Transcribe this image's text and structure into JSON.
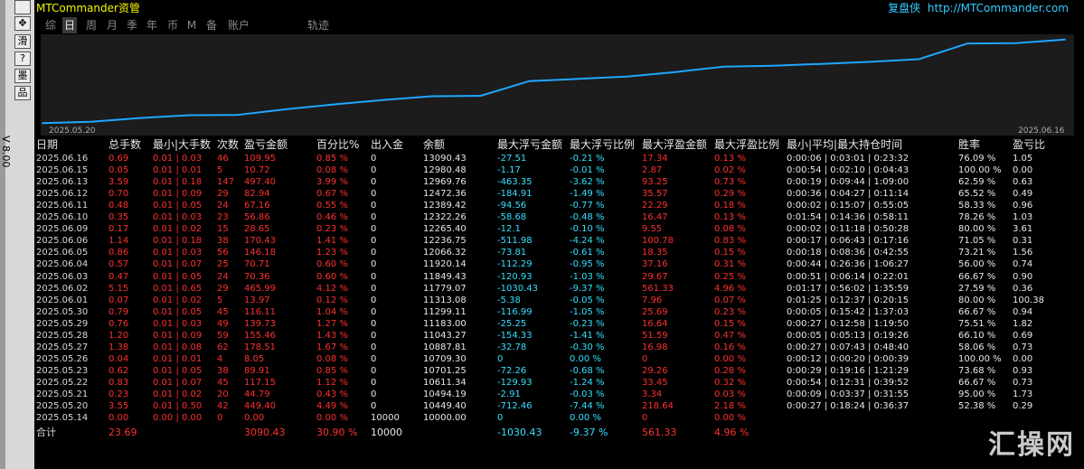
{
  "window": {
    "title": "MTCommander资管",
    "brand_cn": "复盘侠",
    "brand_url": "http://MTCommander.com"
  },
  "side": {
    "vertical_label": "V 8.00",
    "buttons": [
      "",
      "✥",
      "滑",
      "?",
      "墨",
      "品"
    ]
  },
  "tabs": [
    "综",
    "日",
    "周",
    "月",
    "季",
    "年",
    "币",
    "M",
    "备",
    "账户",
    "轨迹"
  ],
  "active_tab": 1,
  "chart_data": {
    "type": "line",
    "x_start_label": "2025.05.20",
    "x_end_label": "2025.06.16",
    "color": "#1ea7ff",
    "values": [
      10449.4,
      10494.19,
      10611.34,
      10701.25,
      10709.3,
      10887.81,
      11043.27,
      11183.0,
      11299.11,
      11313.08,
      11779.07,
      11849.43,
      11920.14,
      12066.32,
      12236.75,
      12265.4,
      12322.26,
      12389.42,
      12472.36,
      12969.76,
      12980.48,
      13090.43
    ]
  },
  "columns": [
    "日期",
    "总手数",
    "最小|大手数",
    "次数",
    "盈亏金额",
    "百分比%",
    "出入金",
    "余额",
    "最大浮亏金额",
    "最大浮亏比例",
    "最大浮盈金额",
    "最大浮盈比例",
    "最小|平均|最大持仓时间",
    "胜率",
    "盈亏比"
  ],
  "rows": [
    [
      "2025.06.16",
      "0.69",
      "0.01 | 0.03",
      "46",
      "109.95",
      "0.85 %",
      "0",
      "13090.43",
      "-27.51",
      "-0.21 %",
      "17.34",
      "0.13 %",
      "0:00:06 | 0:03:01 | 0:23:32",
      "76.09 %",
      "1.05"
    ],
    [
      "2025.06.15",
      "0.05",
      "0.01 | 0.01",
      "5",
      "10.72",
      "0.08 %",
      "0",
      "12980.48",
      "-1.17",
      "-0.01 %",
      "2.87",
      "0.02 %",
      "0:00:54 | 0:02:10 | 0:04:43",
      "100.00 %",
      "0.00"
    ],
    [
      "2025.06.13",
      "3.59",
      "0.01 | 0.18",
      "147",
      "497.40",
      "3.99 %",
      "0",
      "12969.76",
      "-463.35",
      "-3.62 %",
      "93.25",
      "0.73 %",
      "0:00:19 | 0:09:44 | 1:09:00",
      "62.59 %",
      "0.63"
    ],
    [
      "2025.06.12",
      "0.70",
      "0.01 | 0.09",
      "29",
      "82.94",
      "0.67 %",
      "0",
      "12472.36",
      "-184.91",
      "-1.49 %",
      "35.57",
      "0.29 %",
      "0:00:36 | 0:04:27 | 0:11:14",
      "65.52 %",
      "0.49"
    ],
    [
      "2025.06.11",
      "0.48",
      "0.01 | 0.05",
      "24",
      "67.16",
      "0.55 %",
      "0",
      "12389.42",
      "-94.56",
      "-0.77 %",
      "22.29",
      "0.18 %",
      "0:00:02 | 0:15:07 | 0:55:05",
      "58.33 %",
      "0.96"
    ],
    [
      "2025.06.10",
      "0.35",
      "0.01 | 0.03",
      "23",
      "56.86",
      "0.46 %",
      "0",
      "12322.26",
      "-58.68",
      "-0.48 %",
      "16.47",
      "0.13 %",
      "0:01:54 | 0:14:36 | 0:58:11",
      "78.26 %",
      "1.03"
    ],
    [
      "2025.06.09",
      "0.17",
      "0.01 | 0.02",
      "15",
      "28.65",
      "0.23 %",
      "0",
      "12265.40",
      "-12.1",
      "-0.10 %",
      "9.55",
      "0.08 %",
      "0:00:02 | 0:11:18 | 0:50:28",
      "80.00 %",
      "3.61"
    ],
    [
      "2025.06.06",
      "1.14",
      "0.01 | 0.18",
      "38",
      "170.43",
      "1.41 %",
      "0",
      "12236.75",
      "-511.98",
      "-4.24 %",
      "100.78",
      "0.83 %",
      "0:00:17 | 0:06:43 | 0:17:16",
      "71.05 %",
      "0.31"
    ],
    [
      "2025.06.05",
      "0.86",
      "0.01 | 0.03",
      "56",
      "146.18",
      "1.23 %",
      "0",
      "12066.32",
      "-73.81",
      "-0.61 %",
      "18.35",
      "0.15 %",
      "0:00:18 | 0:08:36 | 0:42:55",
      "73.21 %",
      "1.56"
    ],
    [
      "2025.06.04",
      "0.57",
      "0.01 | 0.07",
      "25",
      "70.71",
      "0.60 %",
      "0",
      "11920.14",
      "-112.29",
      "-0.95 %",
      "37.16",
      "0.31 %",
      "0:00:44 | 0:26:36 | 1:06:27",
      "56.00 %",
      "0.74"
    ],
    [
      "2025.06.03",
      "0.47",
      "0.01 | 0.05",
      "24",
      "70.36",
      "0.60 %",
      "0",
      "11849.43",
      "-120.93",
      "-1.03 %",
      "29.67",
      "0.25 %",
      "0:00:51 | 0:06:14 | 0:22:01",
      "66.67 %",
      "0.90"
    ],
    [
      "2025.06.02",
      "5.15",
      "0.01 | 0.65",
      "29",
      "465.99",
      "4.12 %",
      "0",
      "11779.07",
      "-1030.43",
      "-9.37 %",
      "561.33",
      "4.96 %",
      "0:01:17 | 0:56:02 | 1:35:59",
      "27.59 %",
      "0.36"
    ],
    [
      "2025.06.01",
      "0.07",
      "0.01 | 0.02",
      "5",
      "13.97",
      "0.12 %",
      "0",
      "11313.08",
      "-5.38",
      "-0.05 %",
      "7.96",
      "0.07 %",
      "0:01:25 | 0:12:37 | 0:20:15",
      "80.00 %",
      "100.38"
    ],
    [
      "2025.05.30",
      "0.79",
      "0.01 | 0.05",
      "45",
      "116.11",
      "1.04 %",
      "0",
      "11299.11",
      "-116.99",
      "-1.05 %",
      "25.69",
      "0.23 %",
      "0:00:05 | 0:15:42 | 1:37:03",
      "66.67 %",
      "0.94"
    ],
    [
      "2025.05.29",
      "0.76",
      "0.01 | 0.03",
      "49",
      "139.73",
      "1.27 %",
      "0",
      "11183.00",
      "-25.25",
      "-0.23 %",
      "16.64",
      "0.15 %",
      "0:00:27 | 0:12:58 | 1:19:50",
      "75.51 %",
      "1.82"
    ],
    [
      "2025.05.28",
      "1.20",
      "0.01 | 0.09",
      "59",
      "155.46",
      "1.43 %",
      "0",
      "11043.27",
      "-154.33",
      "-1.41 %",
      "51.59",
      "0.47 %",
      "0:00:05 | 0:05:13 | 0:19:26",
      "66.10 %",
      "0.69"
    ],
    [
      "2025.05.27",
      "1.38",
      "0.01 | 0.08",
      "62",
      "178.51",
      "1.67 %",
      "0",
      "10887.81",
      "-32.78",
      "-0.30 %",
      "16.98",
      "0.16 %",
      "0:00:27 | 0:07:43 | 0:48:40",
      "58.06 %",
      "0.73"
    ],
    [
      "2025.05.26",
      "0.04",
      "0.01 | 0.01",
      "4",
      "8.05",
      "0.08 %",
      "0",
      "10709.30",
      "0",
      "0.00 %",
      "0",
      "0.00 %",
      "0:00:12 | 0:00:20 | 0:00:39",
      "100.00 %",
      "0.00"
    ],
    [
      "2025.05.23",
      "0.62",
      "0.01 | 0.05",
      "38",
      "89.91",
      "0.85 %",
      "0",
      "10701.25",
      "-72.26",
      "-0.68 %",
      "29.26",
      "0.28 %",
      "0:00:29 | 0:19:16 | 1:21:29",
      "73.68 %",
      "0.93"
    ],
    [
      "2025.05.22",
      "0.83",
      "0.01 | 0.07",
      "45",
      "117.15",
      "1.12 %",
      "0",
      "10611.34",
      "-129.93",
      "-1.24 %",
      "33.45",
      "0.32 %",
      "0:00:54 | 0:12:31 | 0:39:52",
      "66.67 %",
      "0.73"
    ],
    [
      "2025.05.21",
      "0.23",
      "0.01 | 0.02",
      "20",
      "44.79",
      "0.43 %",
      "0",
      "10494.19",
      "-2.91",
      "-0.03 %",
      "3.34",
      "0.03 %",
      "0:00:09 | 0:03:37 | 0:31:55",
      "95.00 %",
      "1.73"
    ],
    [
      "2025.05.20",
      "3.55",
      "0.01 | 0.50",
      "42",
      "449.40",
      "4.49 %",
      "0",
      "10449.40",
      "-712.46",
      "-7.44 %",
      "218.64",
      "2.18 %",
      "0:00:27 | 0:18:24 | 0:36:37",
      "52.38 %",
      "0.29"
    ],
    [
      "2025.05.14",
      "0.00",
      "0.00 | 0.00",
      "0",
      "0.00",
      "0.00 %",
      "10000",
      "10000.00",
      "0",
      "0.00 %",
      "0",
      "0.00 %",
      "",
      "",
      ""
    ]
  ],
  "total": [
    "合计",
    "23.69",
    "",
    "",
    "3090.43",
    "30.90 %",
    "10000",
    "",
    "-1030.43",
    "-9.37 %",
    "561.33",
    "4.96 %",
    "",
    "",
    ""
  ],
  "watermark": "汇操网"
}
